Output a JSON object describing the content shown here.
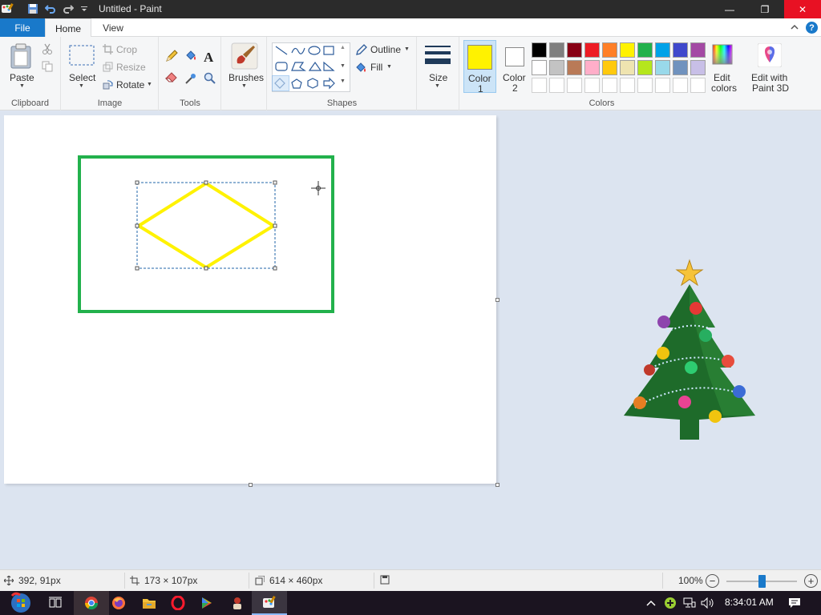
{
  "window": {
    "title": "Untitled - Paint",
    "minimize_glyph": "—",
    "maximize_glyph": "❐",
    "close_glyph": "✕"
  },
  "tabs": [
    {
      "label": "File"
    },
    {
      "label": "Home"
    },
    {
      "label": "View"
    }
  ],
  "help_glyph": "?",
  "clipboard": {
    "paste_label": "Paste",
    "group_label": "Clipboard"
  },
  "image": {
    "select_label": "Select",
    "crop_label": "Crop",
    "resize_label": "Resize",
    "rotate_label": "Rotate",
    "group_label": "Image"
  },
  "tools": {
    "group_label": "Tools",
    "text_glyph": "A"
  },
  "brushes": {
    "label": "Brushes"
  },
  "shapes": {
    "outline_label": "Outline",
    "fill_label": "Fill",
    "group_label": "Shapes"
  },
  "size": {
    "label": "Size"
  },
  "color1": {
    "label_line1": "Color",
    "label_line2": "1",
    "value": "#fff200"
  },
  "color2": {
    "label_line1": "Color",
    "label_line2": "2",
    "value": "#ffffff"
  },
  "colors": {
    "group_label": "Colors",
    "row1": [
      "#000000",
      "#7f7f7f",
      "#880015",
      "#ed1c24",
      "#ff7f27",
      "#fff200",
      "#22b14c",
      "#00a2e8",
      "#3f48cc",
      "#a349a4"
    ],
    "row2": [
      "#ffffff",
      "#c3c3c3",
      "#b97a57",
      "#ffaec9",
      "#ffc90e",
      "#efe4b0",
      "#b5e61d",
      "#99d9ea",
      "#7092be",
      "#c8bfe7"
    ]
  },
  "edit_colors": {
    "line1": "Edit",
    "line2": "colors"
  },
  "paint3d": {
    "line1": "Edit with",
    "line2": "Paint 3D"
  },
  "drawing": {
    "rect_color": "#22b14c",
    "diamond_color": "#fff200"
  },
  "status": {
    "cursor_pos": "392, 91px",
    "selection_size": "173 × 107px",
    "canvas_size": "614 × 460px",
    "zoom": "100%",
    "zoom_minus": "−",
    "zoom_plus": "+"
  },
  "clock": "8:34:01 AM"
}
